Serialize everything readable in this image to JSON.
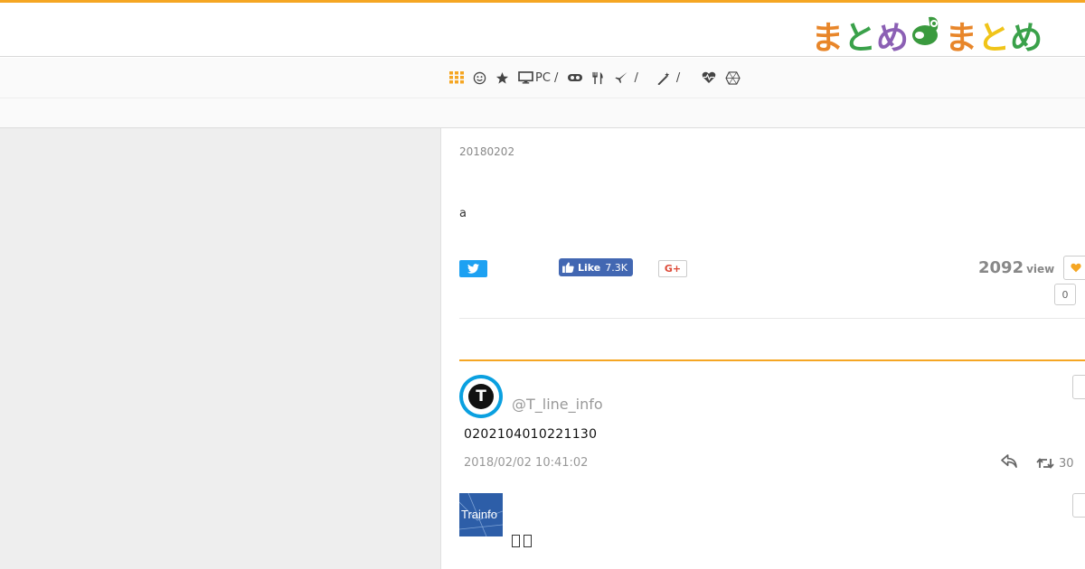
{
  "logo": {
    "chars": [
      {
        "text": "ま",
        "color": "#e8862a"
      },
      {
        "text": "と",
        "color": "#3aa14a"
      },
      {
        "text": "め",
        "color": "#8b5fb4"
      },
      {
        "text": "ま",
        "color": "#e8862a"
      },
      {
        "text": "と",
        "color": "#f0c419"
      },
      {
        "text": "め",
        "color": "#3aa14a"
      }
    ],
    "mascot_color": "#3a9a3e"
  },
  "nav": {
    "items": [
      {
        "icon": "grid-icon",
        "label": ""
      },
      {
        "icon": "smile-icon",
        "label": ""
      },
      {
        "icon": "star-icon",
        "label": ""
      },
      {
        "icon": "monitor-icon",
        "label": "PC /"
      },
      {
        "icon": "gamepad-icon",
        "label": ""
      },
      {
        "icon": "cutlery-icon",
        "label": ""
      },
      {
        "icon": "plane-icon",
        "label": "/"
      },
      {
        "icon": "magic-wand-icon",
        "label": "/"
      },
      {
        "icon": "heartbeat-icon",
        "label": ""
      },
      {
        "icon": "cube-icon",
        "label": ""
      }
    ],
    "active_color": "#f5a623"
  },
  "article": {
    "date": "20180202",
    "body": "a",
    "facebook": {
      "label": "Like",
      "count": "7.3K"
    },
    "gplus_label": "G+",
    "views": {
      "count": "2092",
      "label": "view"
    },
    "favorite_count": "0"
  },
  "tweets": [
    {
      "handle": "@T_line_info",
      "avatar_letter": "T",
      "text": "0202104010221130",
      "date": "2018/02/02 10:41:02",
      "retweets": "30"
    },
    {
      "avatar_label": "Trainfo",
      "text": "  "
    }
  ],
  "colors": {
    "accent": "#f5a623",
    "twitter": "#1da1f2",
    "facebook": "#4267b2",
    "gplus": "#dd4b39"
  }
}
